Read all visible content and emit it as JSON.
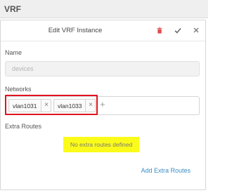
{
  "page": {
    "title": "VRF"
  },
  "dialog": {
    "title": "Edit VRF Instance",
    "icons": {
      "delete": "trash-icon",
      "save": "check-icon",
      "close": "close-icon"
    },
    "colors": {
      "delete": "#e24b4b",
      "accent": "#3a8fc7",
      "highlight": "#fbfb1a",
      "tag_outline": "#e0131f"
    }
  },
  "form": {
    "name_label": "Name",
    "name_value": "devices",
    "networks_label": "Networks",
    "networks": [
      {
        "label": "vlan1031",
        "remove": "×"
      },
      {
        "label": "vlan1033",
        "remove": "×"
      }
    ],
    "add_network": "+",
    "extra_routes_label": "Extra Routes",
    "extra_routes_empty": "No extra routes defined",
    "add_extra_routes": "Add Extra Routes"
  }
}
